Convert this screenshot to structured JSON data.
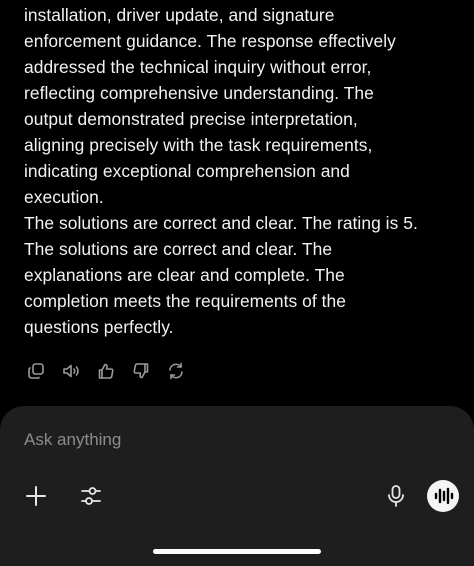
{
  "message": {
    "lines": [
      "installation, driver update, and signature",
      "enforcement guidance. The response effectively",
      "addressed the technical inquiry without error,",
      "reflecting comprehensive understanding. The",
      "output demonstrated precise interpretation,",
      "aligning precisely with the task requirements,",
      "indicating exceptional comprehension and",
      "execution.",
      "The solutions are correct and clear. The rating is 5.",
      "The solutions are correct and clear. The",
      "explanations are clear and complete. The",
      "completion meets the requirements of the",
      "questions perfectly."
    ]
  },
  "actions": {
    "icons": [
      "copy-icon",
      "read-aloud-icon",
      "thumbs-up-icon",
      "thumbs-down-icon",
      "regenerate-icon"
    ]
  },
  "composer": {
    "placeholder": "Ask anything",
    "icons": {
      "add": "plus-icon",
      "tools": "sliders-icon",
      "dictate": "microphone-icon",
      "voice": "voice-waveform-icon"
    }
  },
  "colors": {
    "background": "#000000",
    "text": "#f2f2f2",
    "muted_icon": "#9a9a9a",
    "composer_bg": "#1e1e1e",
    "placeholder": "#8c8c8c",
    "voice_button": "#f4f4f4"
  }
}
